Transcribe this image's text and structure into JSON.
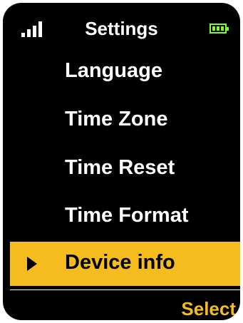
{
  "header": {
    "title": "Settings",
    "signal_icon": "signal-bars-icon",
    "battery_icon": "battery-full-icon"
  },
  "menu": {
    "items": [
      {
        "label": "Language",
        "selected": false
      },
      {
        "label": "Time Zone",
        "selected": false
      },
      {
        "label": "Time Reset",
        "selected": false
      },
      {
        "label": "Time Format",
        "selected": false
      },
      {
        "label": "Device info",
        "selected": true
      }
    ],
    "selection_icon": "play-arrow-icon"
  },
  "footer": {
    "softkey_label": "Select"
  },
  "colors": {
    "background": "#000000",
    "text": "#ffffff",
    "accent": "#F4BC1F",
    "battery": "#7CFC2D"
  }
}
